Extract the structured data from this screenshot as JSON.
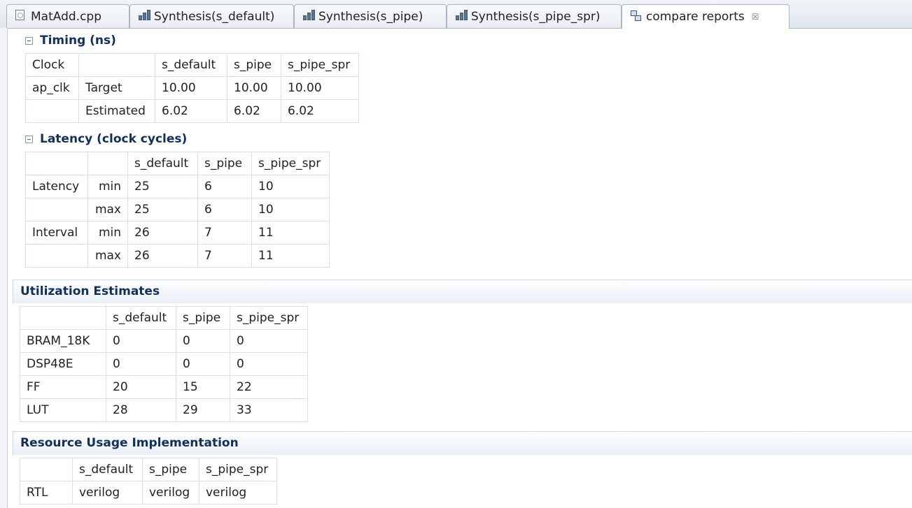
{
  "tabs": [
    {
      "label": "MatAdd.cpp",
      "icon": "file-icon",
      "active": false
    },
    {
      "label": "Synthesis(s_default)",
      "icon": "report-icon",
      "active": false
    },
    {
      "label": "Synthesis(s_pipe)",
      "icon": "report-icon",
      "active": false
    },
    {
      "label": "Synthesis(s_pipe_spr)",
      "icon": "report-icon",
      "active": false
    },
    {
      "label": "compare reports",
      "icon": "compare-icon",
      "active": true
    }
  ],
  "tab_close_glyph": "☒",
  "timing": {
    "title": "Timing (ns)",
    "header": [
      "Clock",
      "",
      "s_default",
      "s_pipe",
      "s_pipe_spr"
    ],
    "rows": [
      [
        "ap_clk",
        "Target",
        "10.00",
        "10.00",
        "10.00"
      ],
      [
        "",
        "Estimated",
        "6.02",
        "6.02",
        "6.02"
      ]
    ]
  },
  "latency": {
    "title": "Latency (clock cycles)",
    "header": [
      "",
      "",
      "s_default",
      "s_pipe",
      "s_pipe_spr"
    ],
    "rows": [
      [
        "Latency",
        "min",
        "25",
        "6",
        "10"
      ],
      [
        "",
        "max",
        "25",
        "6",
        "10"
      ],
      [
        "Interval",
        "min",
        "26",
        "7",
        "11"
      ],
      [
        "",
        "max",
        "26",
        "7",
        "11"
      ]
    ]
  },
  "utilization": {
    "title": "Utilization Estimates",
    "header": [
      "",
      "s_default",
      "s_pipe",
      "s_pipe_spr"
    ],
    "rows": [
      [
        "BRAM_18K",
        "0",
        "0",
        "0"
      ],
      [
        "DSP48E",
        "0",
        "0",
        "0"
      ],
      [
        "FF",
        "20",
        "15",
        "22"
      ],
      [
        "LUT",
        "28",
        "29",
        "33"
      ]
    ]
  },
  "resource": {
    "title": "Resource Usage Implementation",
    "header": [
      "",
      "s_default",
      "s_pipe",
      "s_pipe_spr"
    ],
    "rows": [
      [
        "RTL",
        "verilog",
        "verilog",
        "verilog"
      ]
    ]
  },
  "colors": {
    "section_title": "#12305a",
    "tab_border": "#a9b6c6"
  }
}
